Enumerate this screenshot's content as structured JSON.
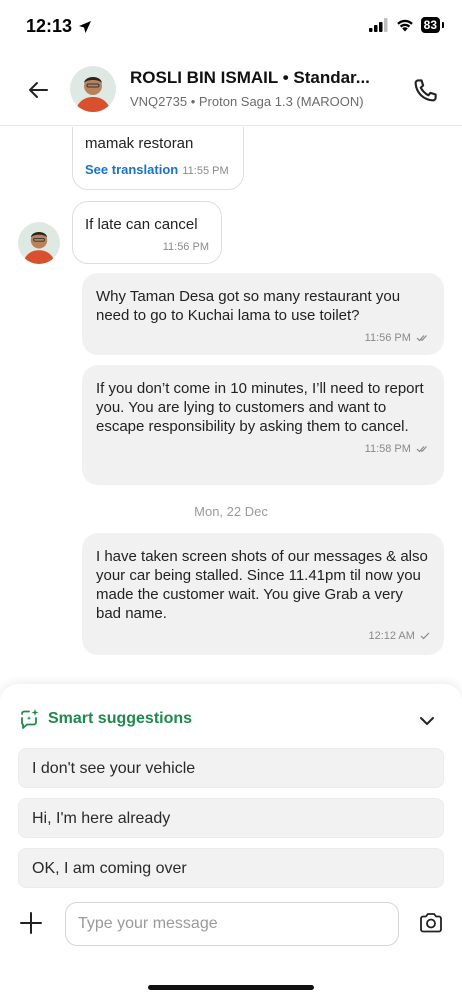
{
  "status_bar": {
    "time": "12:13",
    "battery": "83"
  },
  "header": {
    "driver_name": "ROSLI BIN ISMAIL • Standar...",
    "vehicle_info": "VNQ2735 • Proton Saga 1.3 (MAROON)"
  },
  "messages": [
    {
      "direction": "in",
      "text": "mamak restoran",
      "translation_link": "See translation",
      "time": "11:55 PM"
    },
    {
      "direction": "in",
      "text": "If late can cancel",
      "time": "11:56 PM"
    },
    {
      "direction": "out",
      "text": "Why Taman Desa got so many restaurant you need to go to Kuchai lama to use toilet?",
      "time": "11:56 PM"
    },
    {
      "direction": "out",
      "text": "If you don’t come in 10 minutes, I’ll need to report you. You are lying to customers and want to escape responsibility by asking them to cancel.",
      "time": "11:58 PM"
    },
    {
      "direction": "out",
      "text": "I have taken screen shots of our messages & also your car being stalled. Since 11.41pm til now you made the customer wait. You give Grab a very bad name.",
      "time": "12:12 AM"
    }
  ],
  "date_separator": "Mon, 22 Dec",
  "suggestions": {
    "title": "Smart suggestions",
    "items": [
      "I don't see your vehicle",
      "Hi, I'm here already",
      "OK, I am coming over"
    ]
  },
  "composer": {
    "placeholder": "Type your message"
  },
  "colors": {
    "accent_green": "#1f8a4c",
    "link_blue": "#1a73c7",
    "outgoing_bubble": "#f1f1f1"
  }
}
